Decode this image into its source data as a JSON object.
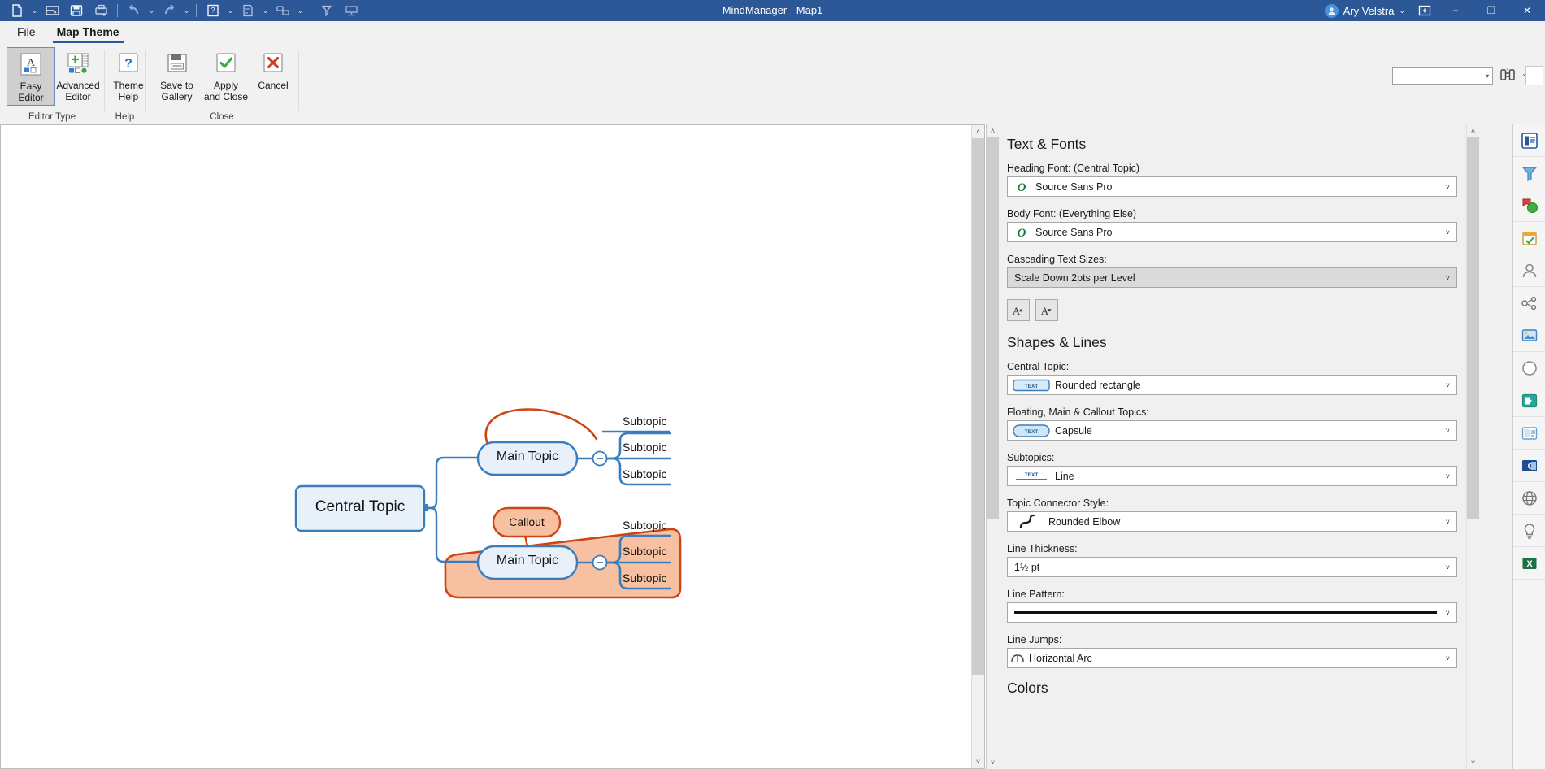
{
  "titlebar": {
    "app_title": "MindManager - Map1",
    "user_name": "Ary Velstra",
    "user_caret": "⌄",
    "quick_access": [
      {
        "name": "new-map-icon",
        "glyph": "new"
      },
      {
        "name": "open-icon",
        "glyph": "open"
      },
      {
        "name": "save-icon",
        "glyph": "save"
      },
      {
        "name": "print-icon",
        "glyph": "print"
      },
      {
        "name": "undo-icon",
        "glyph": "undo"
      },
      {
        "name": "redo-icon",
        "glyph": "redo"
      },
      {
        "name": "new-topic-icon",
        "glyph": "topic"
      },
      {
        "name": "notes-icon",
        "glyph": "notes"
      },
      {
        "name": "relationship-icon",
        "glyph": "rel"
      },
      {
        "name": "filter-icon",
        "glyph": "filter"
      },
      {
        "name": "presentation-icon",
        "glyph": "present"
      }
    ],
    "window_controls": {
      "restore_up": "⊞",
      "minimize": "−",
      "maximize": "❐",
      "close": "✕"
    }
  },
  "ribbon": {
    "tabs": [
      {
        "label": "File",
        "active": false
      },
      {
        "label": "Map Theme",
        "active": true
      }
    ],
    "groups": [
      {
        "label": "Editor Type",
        "buttons": [
          {
            "label": "Easy\nEditor",
            "icon": "easy-editor-icon",
            "selected": true
          },
          {
            "label": "Advanced\nEditor",
            "icon": "advanced-editor-icon",
            "selected": false
          }
        ]
      },
      {
        "label": "Help",
        "buttons": [
          {
            "label": "Theme\nHelp",
            "icon": "theme-help-icon",
            "selected": false
          }
        ]
      },
      {
        "label": "Close",
        "buttons": [
          {
            "label": "Save to\nGallery",
            "icon": "save-to-gallery-icon",
            "selected": false
          },
          {
            "label": "Apply\nand Close",
            "icon": "apply-and-close-icon",
            "selected": false
          },
          {
            "label": "Cancel",
            "icon": "cancel-icon",
            "selected": false
          }
        ]
      }
    ],
    "search": {
      "value": "",
      "placeholder": ""
    },
    "find_icon": "find-binoculars-icon"
  },
  "canvas": {
    "map": {
      "central_topic": {
        "label": "Central Topic"
      },
      "main_topic_upper": {
        "label": "Main Topic"
      },
      "main_topic_lower": {
        "label": "Main Topic"
      },
      "callout": {
        "label": "Callout"
      },
      "subtopics_upper": [
        "Subtopic",
        "Subtopic",
        "Subtopic"
      ],
      "subtopics_lower": [
        "Subtopic",
        "Subtopic",
        "Subtopic"
      ],
      "collapse_glyph": "−"
    },
    "colors": {
      "topic_stroke": "#3a7dbd",
      "topic_fill": "#e8f1fa",
      "boundary_stroke": "#d1471a",
      "boundary_fill": "#f7c7ab",
      "callout_fill": "#f7c0a0",
      "relationship_line": "#cf4413"
    }
  },
  "taskpane": {
    "sections": [
      {
        "heading": "Text & Fonts",
        "fields": [
          {
            "label": "Heading Font: (Central Topic)",
            "value": "Source Sans Pro",
            "icon": "font-o-icon",
            "style": "white"
          },
          {
            "label": "Body Font: (Everything Else)",
            "value": "Source Sans Pro",
            "icon": "font-o-icon",
            "style": "white"
          },
          {
            "label": "Cascading Text Sizes:",
            "value": "Scale Down 2pts per Level",
            "icon": "none",
            "style": "gray"
          }
        ],
        "buttons": [
          {
            "name": "increase-font-size-button",
            "label": "A",
            "dir": "up"
          },
          {
            "name": "decrease-font-size-button",
            "label": "A",
            "dir": "down"
          }
        ]
      },
      {
        "heading": "Shapes & Lines",
        "fields": [
          {
            "label": "Central Topic:",
            "value": "Rounded rectangle",
            "icon": "shape-rounded-rect-icon",
            "style": "white"
          },
          {
            "label": "Floating, Main & Callout Topics:",
            "value": "Capsule",
            "icon": "shape-capsule-icon",
            "style": "white"
          },
          {
            "label": "Subtopics:",
            "value": "Line",
            "icon": "shape-line-icon",
            "style": "white"
          },
          {
            "label": "Topic Connector Style:",
            "value": "Rounded Elbow",
            "icon": "connector-rounded-elbow-icon",
            "style": "white"
          },
          {
            "label": "Line Thickness:",
            "value": "1½ pt",
            "icon": "none",
            "style": "white"
          },
          {
            "label": "Line Pattern:",
            "value": "",
            "icon": "none",
            "style": "white"
          },
          {
            "label": "Line Jumps:",
            "value": "Horizontal Arc",
            "icon": "line-jump-arc-icon",
            "style": "white"
          }
        ],
        "buttons": []
      }
    ],
    "next_heading_partial": "Colors"
  },
  "iconstrip": [
    {
      "name": "map-parts-icon"
    },
    {
      "name": "filter-icon"
    },
    {
      "name": "markers-icon"
    },
    {
      "name": "tasks-icon"
    },
    {
      "name": "contacts-icon"
    },
    {
      "name": "topic-tools-icon"
    },
    {
      "name": "images-icon"
    },
    {
      "name": "shapes-icon"
    },
    {
      "name": "slides-icon"
    },
    {
      "name": "templates-icon"
    },
    {
      "name": "outlook-icon"
    },
    {
      "name": "web-icon"
    },
    {
      "name": "brainstorm-icon"
    },
    {
      "name": "excel-icon"
    }
  ]
}
